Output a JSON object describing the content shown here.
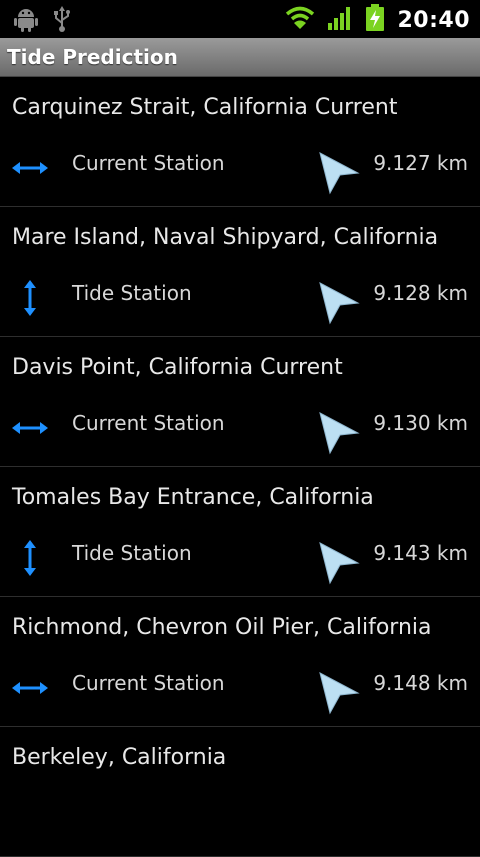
{
  "status_bar": {
    "time": "20:40",
    "icons": [
      "android-debug-icon",
      "usb-icon",
      "wifi-icon",
      "signal-icon",
      "battery-charging-icon"
    ],
    "accent_green": "#7bd321"
  },
  "header": {
    "title": "Tide Prediction"
  },
  "colors": {
    "station_icon_blue": "#1e90ff",
    "direction_arrow": "#bcdff2"
  },
  "stations": [
    {
      "name": "Carquinez Strait, California Current",
      "type": "Current Station",
      "type_icon": "horizontal-arrows-icon",
      "distance": "9.127 km"
    },
    {
      "name": "Mare Island, Naval Shipyard, California",
      "type": "Tide Station",
      "type_icon": "vertical-arrows-icon",
      "distance": "9.128 km"
    },
    {
      "name": "Davis Point, California Current",
      "type": "Current Station",
      "type_icon": "horizontal-arrows-icon",
      "distance": "9.130 km"
    },
    {
      "name": "Tomales Bay Entrance, California",
      "type": "Tide Station",
      "type_icon": "vertical-arrows-icon",
      "distance": "9.143 km"
    },
    {
      "name": "Richmond, Chevron Oil Pier, California",
      "type": "Current Station",
      "type_icon": "horizontal-arrows-icon",
      "distance": "9.148 km"
    },
    {
      "name": "Berkeley, California"
    }
  ]
}
